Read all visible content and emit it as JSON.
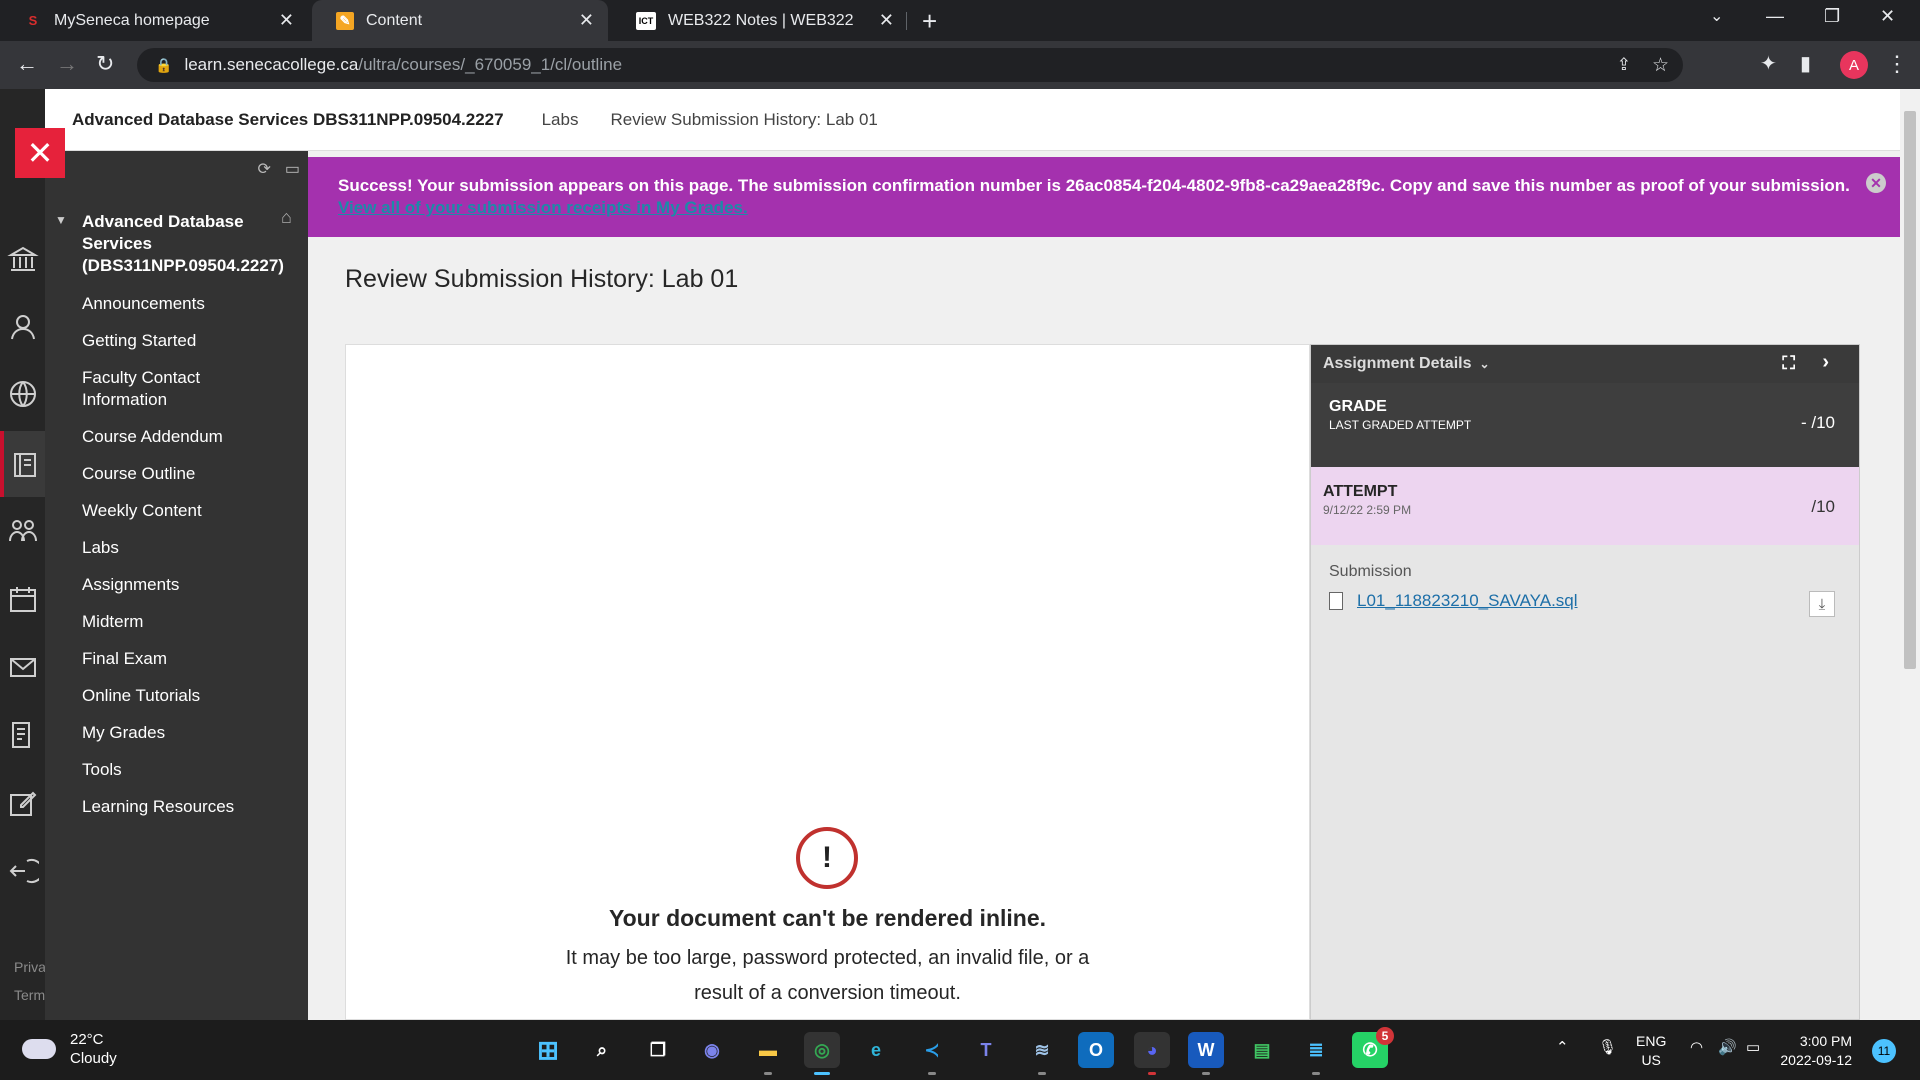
{
  "browser": {
    "tabs": [
      {
        "title": "MySeneca homepage",
        "favicon": "S",
        "favicon_color": "#d92d2d"
      },
      {
        "title": "Content",
        "favicon": "✎",
        "favicon_color": "#f5a623"
      },
      {
        "title": "WEB322 Notes | WEB322",
        "favicon": "ICT",
        "favicon_color": "#ffffff"
      }
    ],
    "url_host": "learn.senecacollege.ca",
    "url_path": "/ultra/courses/_670059_1/cl/outline",
    "profile_initial": "A"
  },
  "breadcrumb": {
    "course": "Advanced Database Services DBS311NPP.09504.2227",
    "items": [
      "Labs",
      "Review Submission History: Lab 01"
    ]
  },
  "left_rail": {
    "footer": [
      "Priva",
      "Term"
    ]
  },
  "course_nav": {
    "title": "Advanced Database Services (DBS311NPP.09504.2227)",
    "items": [
      "Announcements",
      "Getting Started",
      "Faculty Contact Information",
      "Course Addendum",
      "Course Outline",
      "Weekly Content",
      "Labs",
      "Assignments",
      "Midterm",
      "Final Exam",
      "Online Tutorials",
      "My Grades",
      "Tools",
      "Learning Resources"
    ]
  },
  "success": {
    "message": "Success! Your submission appears on this page. The submission confirmation number is 26ac0854-f204-4802-9fb8-ca29aea28f9c. Copy and save this number as proof of your submission.",
    "link": "View all of your submission receipts in My Grades."
  },
  "page_title": "Review Submission History: Lab 01",
  "viewer": {
    "error_icon": "!",
    "error_title": "Your document can't be rendered inline.",
    "error_body": "It may be too large, password protected, an invalid file, or a result of a conversion timeout."
  },
  "assignment_panel": {
    "header": "Assignment Details",
    "grade_label": "GRADE",
    "grade_sub": "LAST GRADED ATTEMPT",
    "grade_score": "- /10",
    "attempt_label": "ATTEMPT",
    "attempt_date": "9/12/22 2:59 PM",
    "attempt_score": "/10",
    "submission_label": "Submission",
    "file_name": "L01_118823210_SAVAYA.sql"
  },
  "taskbar": {
    "temperature": "22°C",
    "condition": "Cloudy",
    "lang_1": "ENG",
    "lang_2": "US",
    "time": "3:00 PM",
    "date": "2022-09-12",
    "notification_count": "11",
    "whatsapp_badge": "5"
  },
  "colors": {
    "success_banner": "#a431ae",
    "close_button": "#e6223b",
    "nav_background": "#333333",
    "attempt_background": "#edd5f0"
  }
}
